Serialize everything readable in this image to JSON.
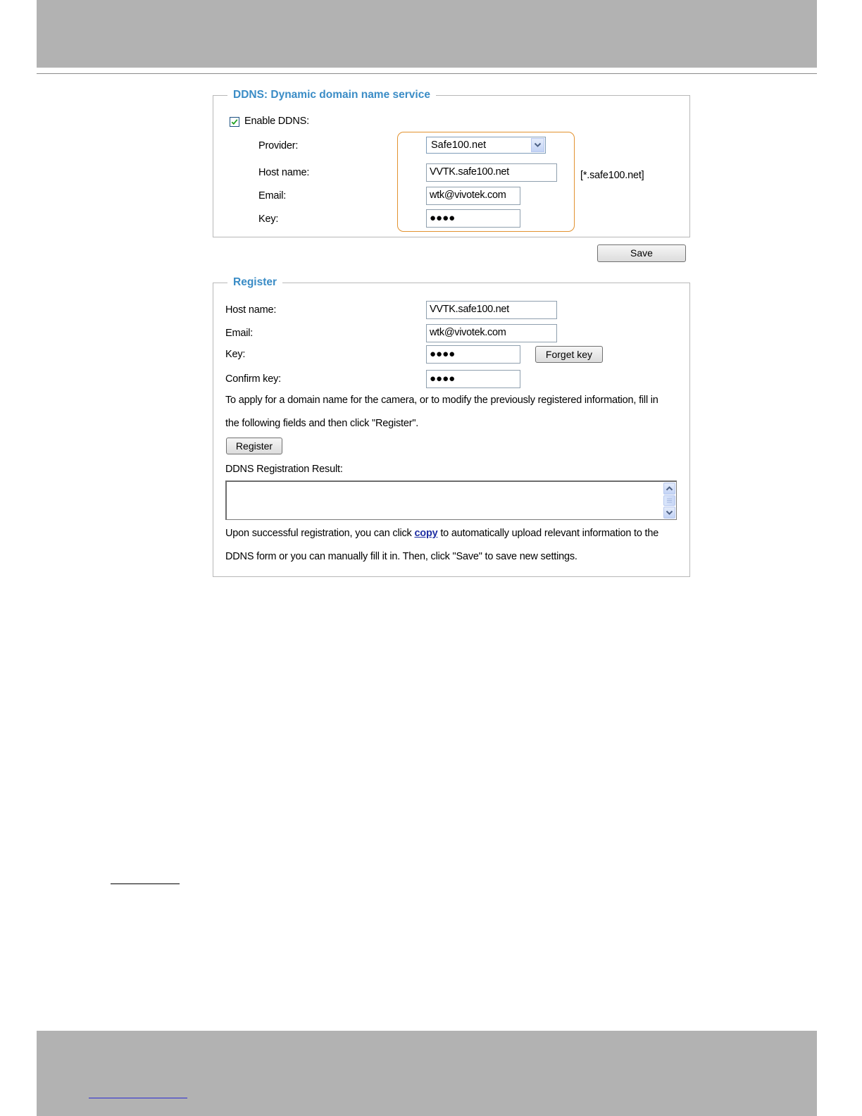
{
  "ddns": {
    "legend": "DDNS: Dynamic domain name service",
    "enable_label": "Enable DDNS:",
    "enable_checked": true,
    "provider_label": "Provider:",
    "provider_value": "Safe100.net",
    "host_label": "Host name:",
    "host_value": "VVTK.safe100.net",
    "host_suffix": "[*.safe100.net]",
    "email_label": "Email:",
    "email_value": "wtk@vivotek.com",
    "key_label": "Key:",
    "key_value": "●●●●",
    "highlight_color": "#e2922f"
  },
  "save_button": "Save",
  "register": {
    "legend": "Register",
    "host_label": "Host name:",
    "host_value": "VVTK.safe100.net",
    "email_label": "Email:",
    "email_value": "wtk@vivotek.com",
    "key_label": "Key:",
    "key_value": "●●●●",
    "forget_key_button": "Forget key",
    "confirm_key_label": "Confirm key:",
    "confirm_key_value": "●●●●",
    "instructions_line1": "To apply for a domain name for the camera, or to modify the previously registered information, fill in",
    "instructions_line2": "the following fields and then click \"Register\".",
    "register_button": "Register",
    "result_label": "DDNS Registration Result:",
    "result_value": "",
    "upon_prefix": "Upon successful registration, you can click ",
    "copy_link": "copy",
    "upon_suffix": " to automatically upload relevant information to the",
    "upon_line2": "DDNS form or you can manually fill it in. Then, click \"Save\" to save new settings."
  },
  "colors": {
    "legend": "#3a8cc6",
    "band": "#b2b2b2",
    "link": "#1f2fa3"
  }
}
